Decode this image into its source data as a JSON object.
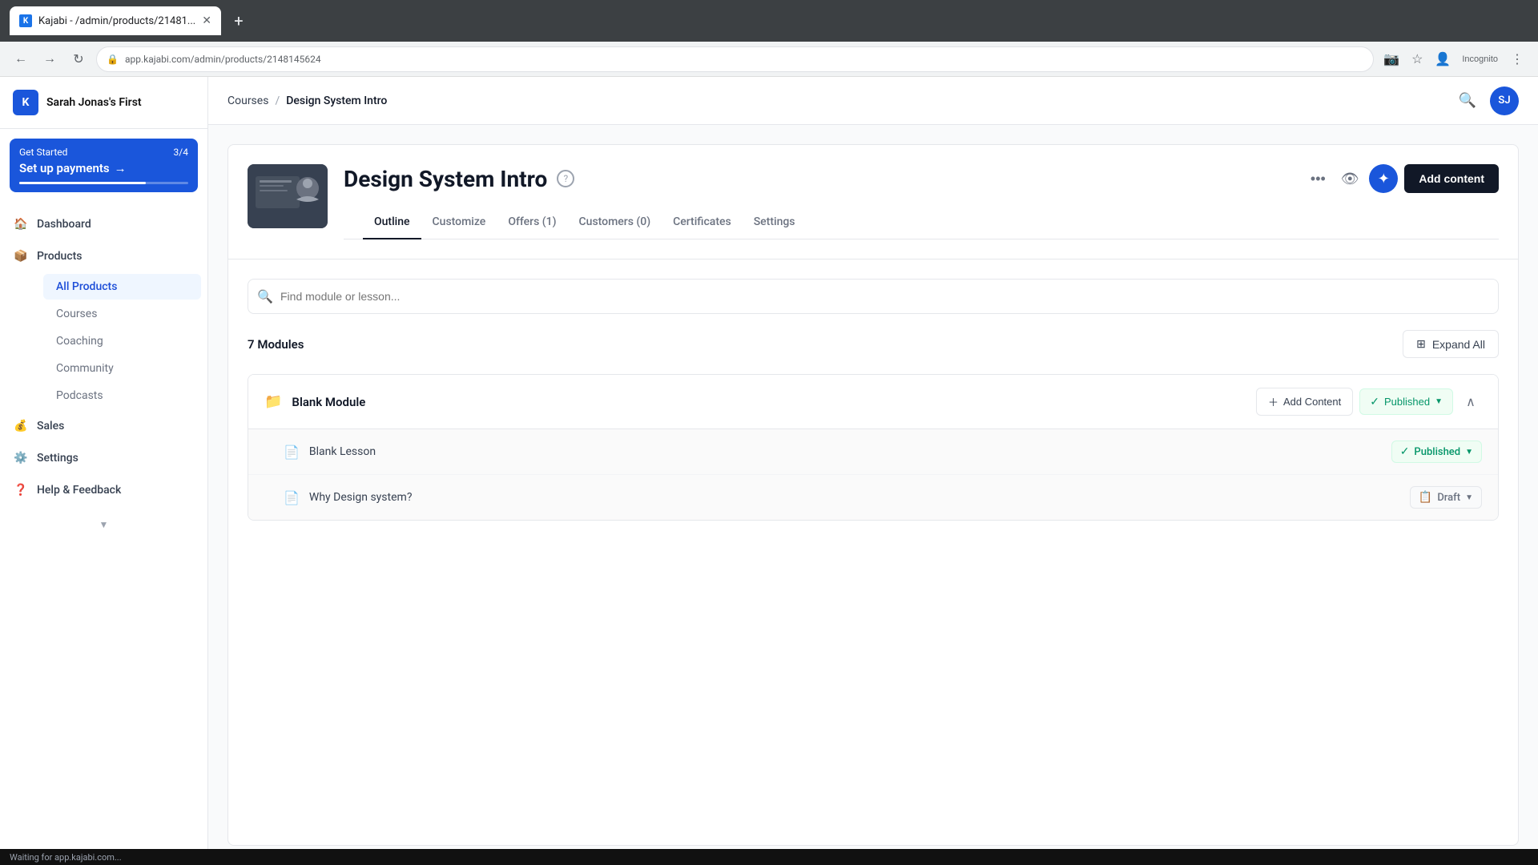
{
  "browser": {
    "tab_title": "Kajabi - /admin/products/21481...",
    "tab_icon": "K",
    "url": "app.kajabi.com/admin/products/2148145624",
    "new_tab_label": "+"
  },
  "sidebar": {
    "brand": "Sarah Jonas's First",
    "logo_text": "K",
    "get_started": {
      "label": "Get Started",
      "progress": "3/4",
      "cta": "Set up payments",
      "arrow": "→"
    },
    "nav_items": [
      {
        "id": "dashboard",
        "label": "Dashboard",
        "icon": "🏠"
      },
      {
        "id": "products",
        "label": "Products",
        "icon": "📦"
      }
    ],
    "sub_items": [
      {
        "id": "all-products",
        "label": "All Products",
        "active": true
      },
      {
        "id": "courses",
        "label": "Courses",
        "active": false
      },
      {
        "id": "coaching",
        "label": "Coaching",
        "active": false
      },
      {
        "id": "community",
        "label": "Community",
        "active": false
      },
      {
        "id": "podcasts",
        "label": "Podcasts",
        "active": false
      }
    ],
    "bottom_nav": [
      {
        "id": "sales",
        "label": "Sales",
        "icon": "💰"
      },
      {
        "id": "settings",
        "label": "Settings",
        "icon": "⚙️"
      },
      {
        "id": "help",
        "label": "Help & Feedback",
        "icon": "❓"
      }
    ]
  },
  "header": {
    "breadcrumb_link": "Courses",
    "breadcrumb_sep": "/",
    "breadcrumb_current": "Design System Intro",
    "avatar_initials": "SJ"
  },
  "course": {
    "title": "Design System Intro",
    "add_content_label": "Add content",
    "tabs": [
      {
        "id": "outline",
        "label": "Outline",
        "active": true
      },
      {
        "id": "customize",
        "label": "Customize",
        "active": false
      },
      {
        "id": "offers",
        "label": "Offers (1)",
        "active": false
      },
      {
        "id": "customers",
        "label": "Customers (0)",
        "active": false
      },
      {
        "id": "certificates",
        "label": "Certificates",
        "active": false
      },
      {
        "id": "settings",
        "label": "Settings",
        "active": false
      }
    ]
  },
  "outline": {
    "search_placeholder": "Find module or lesson...",
    "modules_count": "7",
    "modules_label": "Modules",
    "expand_all_label": "Expand All",
    "modules": [
      {
        "id": "blank-module",
        "name": "Blank Module",
        "add_content_label": "Add Content",
        "status": "Published",
        "status_type": "published",
        "expanded": true,
        "lessons": [
          {
            "id": "blank-lesson",
            "name": "Blank Lesson",
            "status": "Published",
            "status_type": "published"
          },
          {
            "id": "why-design-system",
            "name": "Why Design system?",
            "status": "Draft",
            "status_type": "draft"
          }
        ]
      }
    ]
  },
  "status_bar": {
    "text": "Waiting for app.kajabi.com..."
  }
}
